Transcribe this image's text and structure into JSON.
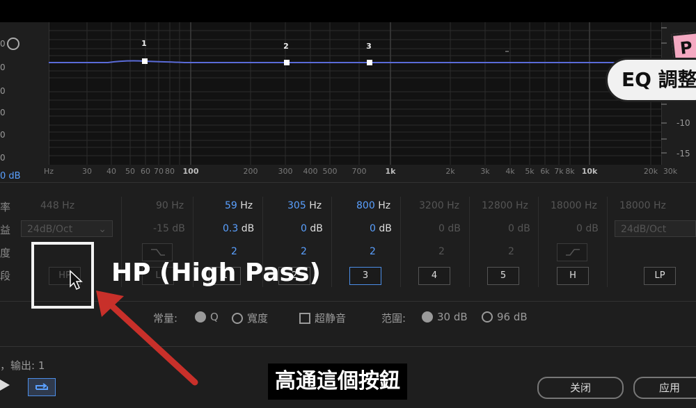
{
  "graph": {
    "left_ticks": [
      "0",
      "0",
      "0",
      "0",
      "0",
      "0"
    ],
    "left_unit": "0 dB",
    "right_ticks": [
      "-10",
      "-15"
    ],
    "x_ticks": [
      "Hz",
      "30",
      "40",
      "50",
      "60",
      "70",
      "80",
      "100",
      "200",
      "300",
      "400",
      "500",
      "700",
      "1k",
      "2k",
      "3k",
      "4k",
      "5k",
      "6k",
      "7k",
      "8k",
      "10k",
      "20k",
      "30k"
    ],
    "band_labels": [
      "1",
      "2",
      "3"
    ]
  },
  "rows": {
    "freq": "率",
    "gain": "益",
    "width": "度",
    "band": "段"
  },
  "bands": [
    {
      "freq": "448 Hz",
      "gain": "24dB/Oct",
      "width": "",
      "button": "HP",
      "state": "disabled"
    },
    {
      "freq": "90 Hz",
      "gain": "-15 dB",
      "width": "",
      "button": "L",
      "state": "disabled"
    },
    {
      "freq_num": "59",
      "freq_unit": "Hz",
      "gain_num": "0.3",
      "gain_unit": "dB",
      "width": "2",
      "button": "1",
      "state": "active"
    },
    {
      "freq_num": "305",
      "freq_unit": "Hz",
      "gain_num": "0",
      "gain_unit": "dB",
      "width": "2",
      "button": "2",
      "state": "active"
    },
    {
      "freq_num": "800",
      "freq_unit": "Hz",
      "gain_num": "0",
      "gain_unit": "dB",
      "width": "2",
      "button": "3",
      "state": "selected"
    },
    {
      "freq": "3200 Hz",
      "gain": "0 dB",
      "width": "2",
      "button": "4",
      "state": "inactive"
    },
    {
      "freq": "12800 Hz",
      "gain": "0 dB",
      "width": "2",
      "button": "5",
      "state": "inactive"
    },
    {
      "freq": "18000 Hz",
      "gain": "0 dB",
      "width": "",
      "button": "H",
      "state": "inactive"
    },
    {
      "freq": "18000 Hz",
      "gain": "24dB/Oct",
      "width": "",
      "button": "LP",
      "state": "inactive"
    }
  ],
  "options": {
    "constant_label": "常量:",
    "q_label": "Q",
    "width_label": "寬度",
    "ultra_quiet_label": "超静音",
    "range_label": "范圍:",
    "range_30": "30 dB",
    "range_96": "96 dB"
  },
  "footer": {
    "io_text": "，输出: 1",
    "close_label": "关闭",
    "apply_label": "应用"
  },
  "overlay": {
    "hp_title": "HP (High Pass)",
    "subtitle": "高通這個按鈕",
    "pill_text": "EQ 調整",
    "pink_text": "P"
  },
  "colors": {
    "accent": "#4c8ee8",
    "curve": "#5a6bd8",
    "blue_value": "#5aa0ff"
  }
}
